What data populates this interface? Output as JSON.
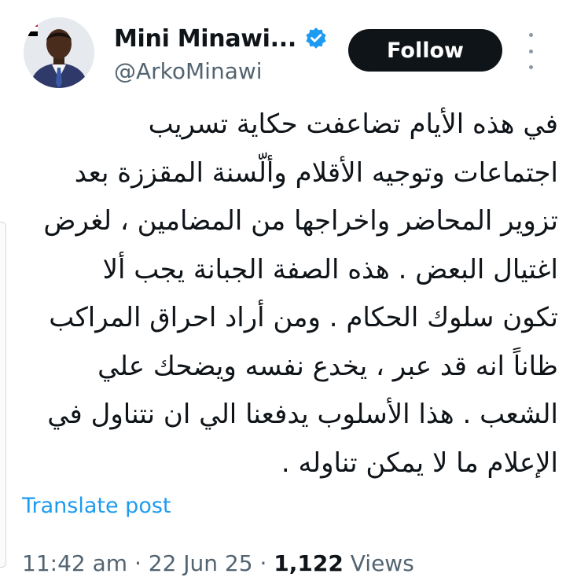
{
  "user": {
    "display_name": "Mini Minawi...",
    "handle": "@ArkoMinawi",
    "verified": true,
    "avatar_icon": "profile-photo"
  },
  "actions": {
    "follow_label": "Follow",
    "more_icon": "more-vertical-icon"
  },
  "post": {
    "text": "في هذه الأيام تضاعفت حكاية تسريب\nاجتماعات وتوجيه الأقلام وألّسنة المقززة بعد\nتزوير المحاضر واخراجها من المضامين ، لغرض\nاغتيال البعض . هذه الصفة الجبانة يجب ألا\nتكون سلوك الحكام . ومن أراد احراق المراكب\nظاناً انه قد عبر ، يخدع نفسه ويضحك علي\nالشعب . هذا الأسلوب يدفعنا الي ان نتناول في\nالإعلام ما لا يمكن تناوله .",
    "translate_label": "Translate post"
  },
  "meta": {
    "time": "11:42 am",
    "separator": "·",
    "date": "22 Jun 25",
    "views_count": "1,122",
    "views_label": "Views"
  },
  "colors": {
    "text": "#0f1419",
    "secondary": "#536471",
    "link": "#1d9bf0",
    "verified": "#1d9bf0",
    "button_bg": "#0f1419"
  }
}
